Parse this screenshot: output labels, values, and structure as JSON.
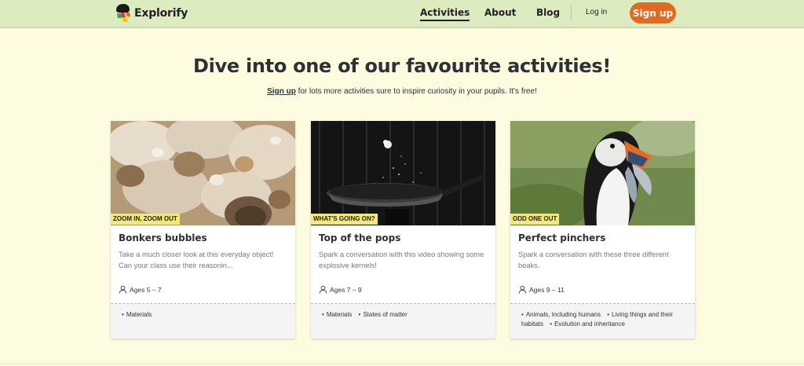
{
  "brand": {
    "name": "Explorify"
  },
  "nav": {
    "links": [
      {
        "label": "Activities",
        "active": true
      },
      {
        "label": "About",
        "active": false
      },
      {
        "label": "Blog",
        "active": false
      }
    ],
    "login_label": "Log in",
    "signup_label": "Sign up"
  },
  "hero": {
    "title": "Dive into one of our favourite activities!",
    "signup_link": "Sign up",
    "subtitle_rest": " for lots more activities sure to inspire curiosity in your pupils. It's free!"
  },
  "cards": [
    {
      "tag": "ZOOM IN, ZOOM OUT",
      "title": "Bonkers bubbles",
      "description": "Take a much closer look at this everyday object! Can your class use their reasonin...",
      "ages": "Ages 5 – 7",
      "topics": [
        "Materials"
      ]
    },
    {
      "tag": "WHAT'S GOING ON?",
      "title": "Top of the pops",
      "description": "Spark a conversation with this video showing some explosive kernels!",
      "ages": "Ages 7 – 9",
      "topics": [
        "Materials",
        "States of matter"
      ]
    },
    {
      "tag": "ODD ONE OUT",
      "title": "Perfect pinchers",
      "description": "Spark a conversation with these three different beaks.",
      "ages": "Ages 9 – 11",
      "topics": [
        "Animals, including humans",
        "Living things and their habitats",
        "Evolution and inheritance"
      ]
    }
  ],
  "colors": {
    "nav_bg": "#dcebc0",
    "page_bg": "#fdfbe0",
    "accent": "#e4691e",
    "tag_bg": "#f4e878"
  },
  "icons": {
    "logo": "explorify-logo-icon",
    "ages": "person-icon"
  }
}
